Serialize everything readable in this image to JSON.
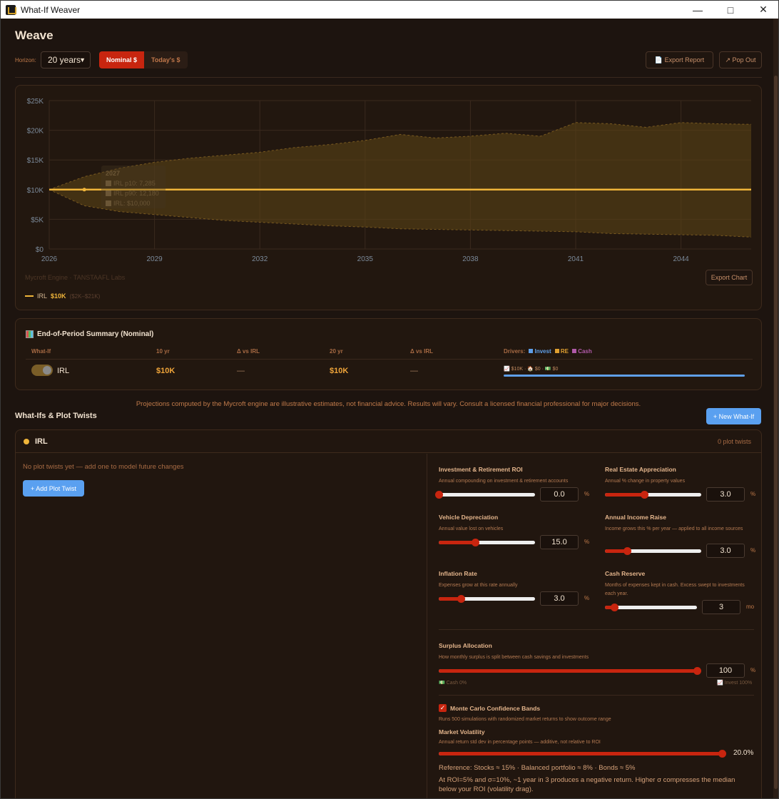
{
  "window": {
    "title": "What-If Weaver"
  },
  "page": {
    "title": "Weave"
  },
  "toolbar": {
    "horizon_label": "Horizon:",
    "horizon_value": "20 years",
    "nominal_label": "Nominal $",
    "todays_label": "Today's $",
    "export_report_label": "📄 Export Report",
    "pop_out_label": "↗ Pop Out"
  },
  "chart": {
    "watermark": "Mycroft Engine · TANSTAAFL Labs",
    "export_label": "Export Chart",
    "legend": {
      "name": "IRL",
      "value": "$10K",
      "range": "($2K–$21K)"
    },
    "tooltip": {
      "title": "2027",
      "line1": "IRL p10: 7,285",
      "line2": "IRL p90: 12,180",
      "line3": "IRL: $10,000"
    }
  },
  "chart_data": {
    "type": "area",
    "x": [
      2026,
      2027,
      2028,
      2029,
      2030,
      2031,
      2032,
      2033,
      2034,
      2035,
      2036,
      2037,
      2038,
      2039,
      2040,
      2041,
      2042,
      2043,
      2044,
      2045,
      2046
    ],
    "series": [
      {
        "name": "IRL",
        "values": [
          10000,
          10000,
          10000,
          10000,
          10000,
          10000,
          10000,
          10000,
          10000,
          10000,
          10000,
          10000,
          10000,
          10000,
          10000,
          10000,
          10000,
          10000,
          10000,
          10000,
          10000
        ]
      },
      {
        "name": "IRL p90",
        "values": [
          10000,
          12180,
          13600,
          14600,
          15300,
          15800,
          16300,
          17100,
          17600,
          18300,
          19300,
          18700,
          19000,
          19500,
          19000,
          21300,
          21100,
          20500,
          21300,
          21100,
          21000
        ]
      },
      {
        "name": "IRL p10",
        "values": [
          10000,
          7285,
          6300,
          5800,
          5300,
          4800,
          4500,
          4200,
          3900,
          3700,
          3400,
          3300,
          3200,
          3100,
          3000,
          2900,
          2600,
          2500,
          2400,
          2300,
          2000
        ]
      }
    ],
    "x_ticks": [
      "2026",
      "2029",
      "2032",
      "2035",
      "2038",
      "2041",
      "2044"
    ],
    "y_ticks": [
      "$0",
      "$5K",
      "$10K",
      "$15K",
      "$20K",
      "$25K"
    ],
    "ylim": [
      0,
      25000
    ],
    "grid": true,
    "colors": {
      "median": "#f0b53a",
      "band": "#5a4216"
    }
  },
  "summary": {
    "title": "End-of-Period Summary (Nominal)",
    "headers": {
      "whatif": "What-If",
      "yr10": "10 yr",
      "delta10": "Δ vs IRL",
      "yr20": "20 yr",
      "delta20": "Δ vs IRL"
    },
    "drivers": {
      "label": "Drivers:",
      "invest": "Invest",
      "re": "RE",
      "cash": "Cash"
    },
    "row": {
      "name": "IRL",
      "yr10": "$10K",
      "delta10": "—",
      "yr20": "$10K",
      "delta20": "—",
      "drivers": "📈 $10K · 🏠 $0 · 💵 $0"
    }
  },
  "disclaimer": "Projections computed by the Mycroft engine are illustrative estimates, not financial advice. Results will vary. Consult a licensed financial professional for major decisions.",
  "whatifs": {
    "title": "What-Ifs & Plot Twists",
    "new_label": "+ New What-If",
    "item": {
      "name": "IRL",
      "count": "0 plot twists",
      "empty": "No plot twists yet — add one to model future changes",
      "add_label": "+ Add Plot Twist"
    }
  },
  "params": {
    "roi": {
      "title": "Investment & Retirement ROI",
      "desc": "Annual compounding on investment & retirement accounts",
      "value": "0.0",
      "unit": "%",
      "level": 0.0
    },
    "re": {
      "title": "Real Estate Appreciation",
      "desc": "Annual % change in property values",
      "value": "3.0",
      "unit": "%",
      "level": 0.41
    },
    "vehicle": {
      "title": "Vehicle Depreciation",
      "desc": "Annual value lost on vehicles",
      "value": "15.0",
      "unit": "%",
      "level": 0.38
    },
    "income": {
      "title": "Annual Income Raise",
      "desc": "Income grows this % per year — applied to all income sources",
      "value": "3.0",
      "unit": "%",
      "level": 0.23
    },
    "inflation": {
      "title": "Inflation Rate",
      "desc": "Expenses grow at this rate annually",
      "value": "3.0",
      "unit": "%",
      "level": 0.23
    },
    "cash": {
      "title": "Cash Reserve",
      "desc": "Months of expenses kept in cash. Excess swept to investments each year.",
      "value": "3",
      "unit": "mo",
      "level": 0.1
    },
    "surplus": {
      "title": "Surplus Allocation",
      "desc": "How monthly surplus is split between cash savings and investments",
      "value": "100",
      "unit": "%",
      "level": 1.0,
      "left_label": "💵 Cash 0%",
      "right_label": "📈 Invest 100%"
    },
    "monte_carlo": {
      "title": "Monte Carlo Confidence Bands",
      "desc": "Runs 500 simulations with randomized market returns to show outcome range"
    },
    "volatility": {
      "title": "Market Volatility",
      "desc": "Annual return std dev in percentage points — additive, not relative to ROI",
      "value": "20.0%",
      "level": 1.0,
      "ref1": "Reference: Stocks ≈ 15% · Balanced portfolio ≈ 8% · Bonds ≈ 5%",
      "ref2": "At ROI=5% and σ=10%, ~1 year in 3 produces a negative return. Higher σ compresses the median below your ROI (volatility drag)."
    }
  }
}
